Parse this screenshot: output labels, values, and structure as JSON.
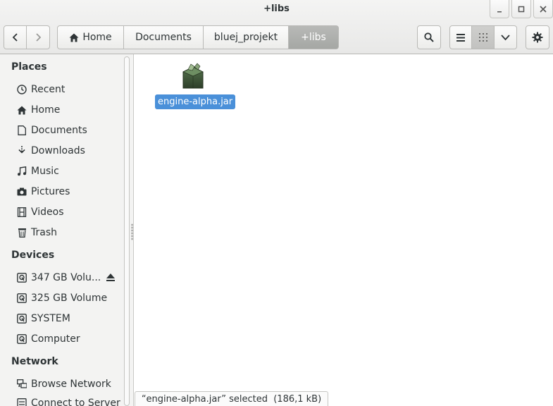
{
  "window": {
    "title": "+libs",
    "minimize_icon": "minimize-icon",
    "maximize_icon": "maximize-icon",
    "close_icon": "close-icon"
  },
  "toolbar": {
    "back_icon": "chevron-left-icon",
    "forward_icon": "chevron-right-icon",
    "search_icon": "search-icon",
    "list_view_icon": "list-view-icon",
    "grid_view_icon": "grid-view-icon",
    "view_menu_icon": "chevron-down-icon",
    "gear_icon": "gear-icon"
  },
  "breadcrumb": [
    {
      "label": "Home",
      "icon": "home-icon"
    },
    {
      "label": "Documents"
    },
    {
      "label": "bluej_projekt"
    },
    {
      "label": "+libs",
      "active": true
    }
  ],
  "sidebar": {
    "places_title": "Places",
    "places": [
      {
        "label": "Recent",
        "icon": "clock-icon"
      },
      {
        "label": "Home",
        "icon": "home-icon"
      },
      {
        "label": "Documents",
        "icon": "document-icon"
      },
      {
        "label": "Downloads",
        "icon": "download-icon"
      },
      {
        "label": "Music",
        "icon": "music-icon"
      },
      {
        "label": "Pictures",
        "icon": "camera-icon"
      },
      {
        "label": "Videos",
        "icon": "film-icon"
      },
      {
        "label": "Trash",
        "icon": "trash-icon"
      }
    ],
    "devices_title": "Devices",
    "devices": [
      {
        "label": "347 GB Volu...",
        "icon": "drive-icon",
        "eject": true
      },
      {
        "label": "325 GB Volume",
        "icon": "drive-icon"
      },
      {
        "label": "SYSTEM",
        "icon": "drive-icon"
      },
      {
        "label": "Computer",
        "icon": "drive-icon"
      }
    ],
    "network_title": "Network",
    "network": [
      {
        "label": "Browse Network",
        "icon": "network-icon"
      },
      {
        "label": "Connect to Server",
        "icon": "server-icon"
      }
    ]
  },
  "content": {
    "files": [
      {
        "name": "engine-alpha.jar",
        "icon": "jar-package-icon",
        "selected": true
      }
    ]
  },
  "status_bar": {
    "text": "“engine-alpha.jar” selected  (186,1 kB)"
  },
  "colors": {
    "selection": "#4a90d9",
    "active_crumb": "#a8aaa7"
  }
}
